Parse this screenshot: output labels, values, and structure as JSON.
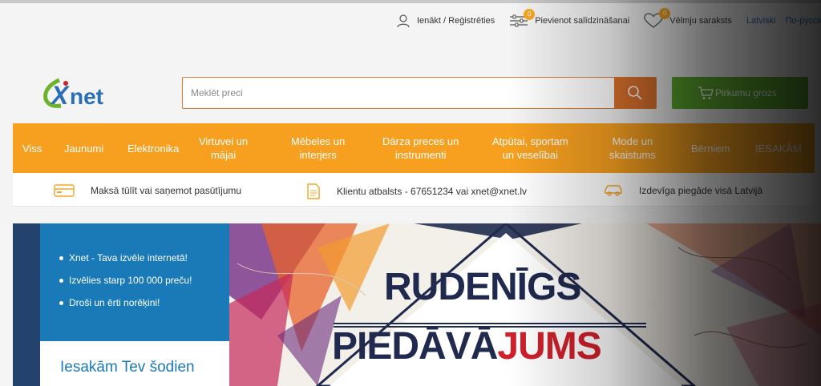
{
  "header": {
    "login_label": "Ienākt / Reģistrēties",
    "compare_label": "Pievienot salīdzināšanai",
    "compare_count": "0",
    "wishlist_label": "Vēlmju saraksts",
    "wishlist_count": "0",
    "lang_label": "Latviski",
    "lang_ru": "По-русски"
  },
  "logo": {
    "text": "Xnet",
    "icon": "xnet-logo"
  },
  "search": {
    "placeholder": "Meklēt preci",
    "value": "",
    "icon": "search-icon"
  },
  "cart": {
    "label": "Pirkumu grozs",
    "icon": "cart-icon"
  },
  "nav": {
    "items": [
      "Viss",
      "Jaunumi",
      "Elektronika",
      "Virtuvei un\nmājai",
      "Mēbeles un\ninterjers",
      "Dārza preces un\ninstrumenti",
      "Atpūtai, sportam\nun veselībai",
      "Mode un\nskaistums",
      "Bērniem",
      "IESAKĀM"
    ]
  },
  "info": {
    "payment": "Maksā tūlīt vai saņemot pasūtījumu",
    "support": "Klientu atbalsts - 67651234 vai xnet@xnet.lv",
    "delivery": "Izdevīga piegāde visā Latvijā"
  },
  "banner": {
    "bullets": [
      "Xnet - Tava izvēle internetā!",
      "Izvēlies starp 100 000 preču!",
      "Droši un ērti norēķini!"
    ],
    "recommend_title": "Iesakām Tev šodien",
    "headline_line1": "RUDENĪGS",
    "headline_line2_a": "PIEDĀVĀ",
    "headline_line2_b": "JUMS"
  },
  "colors": {
    "orange_nav": "#f7a01f",
    "search_orange": "#e0732c",
    "cart_green": "#5fad2f",
    "brand_blue": "#1a7ab8",
    "navy": "#1f2a4e",
    "red": "#d0202b"
  }
}
